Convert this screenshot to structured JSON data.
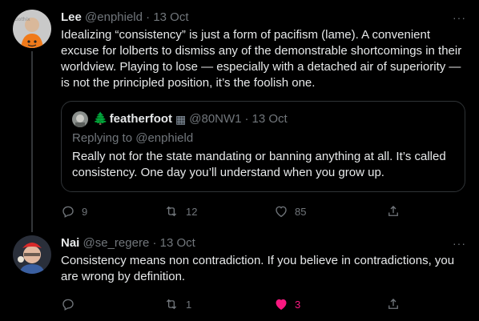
{
  "tweet1": {
    "avatar_caption": "Gothix",
    "display_name": "Lee",
    "handle": "@enphield",
    "dot": "·",
    "date": "13 Oct",
    "more_label": "···",
    "text": "Idealizing “consistency” is just a form of pacifism (lame). A convenient excuse for lolberts to dismiss any of the demonstrable shortcomings in their worldview. Playing to lose — especially with a detached air of superiority — is not the principled position, it’s the foolish one.",
    "quote": {
      "tree_emoji": "🌲",
      "display_name": "featherfoot",
      "badge": "▦",
      "handle": "@80NW1",
      "dot": "·",
      "date": "13 Oct",
      "replying_prefix": "Replying to ",
      "replying_handle": "@enphield",
      "text": "Really not for the state mandating or banning anything at all. It’s called consistency. One day you’ll understand when you grow up."
    },
    "stats": {
      "replies": "9",
      "retweets": "12",
      "likes": "85"
    }
  },
  "tweet2": {
    "display_name": "Nai",
    "handle": "@se_regere",
    "dot": "·",
    "date": "13 Oct",
    "more_label": "···",
    "text": "Consistency means non contradiction. If you believe in contradictions, you are wrong by definition.",
    "stats": {
      "replies": "",
      "retweets": "1",
      "likes": "3"
    }
  },
  "colors": {
    "background": "#000000",
    "text": "#e7e9ea",
    "muted": "#71767b",
    "like_active": "#f91880",
    "border": "#2f3336"
  },
  "icons": {
    "reply": "reply-icon",
    "retweet": "retweet-icon",
    "like": "heart-icon",
    "share": "share-icon",
    "more": "more-icon"
  }
}
